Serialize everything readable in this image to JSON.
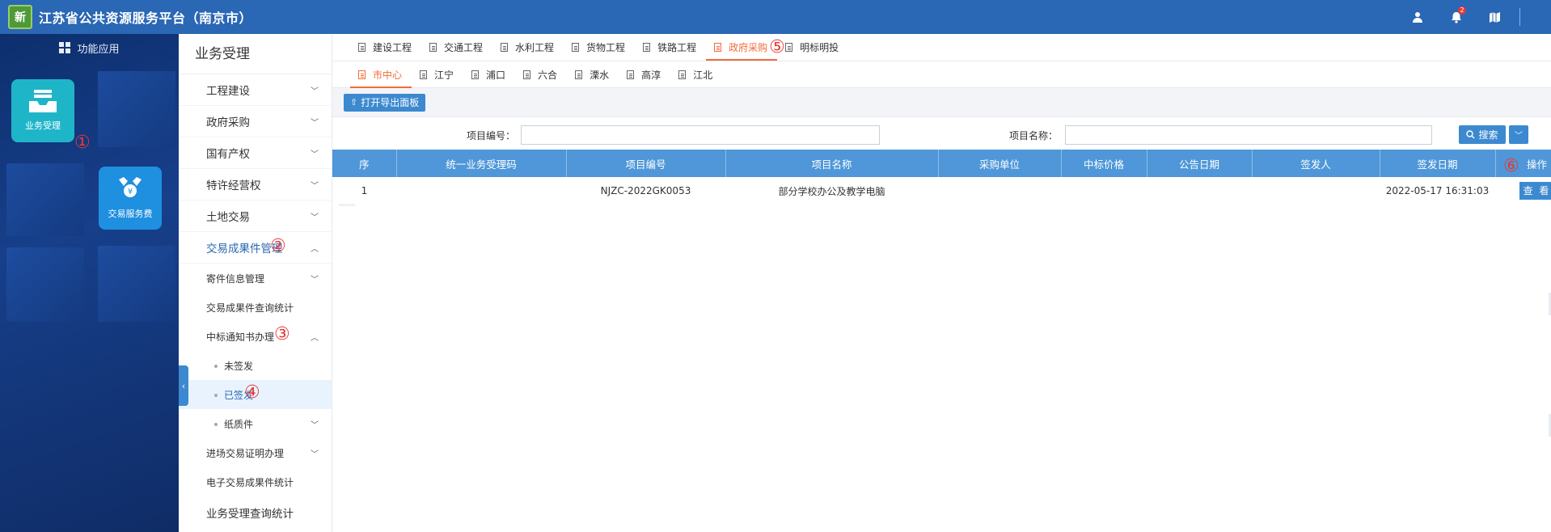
{
  "header": {
    "logo_text": "新",
    "title": "江苏省公共资源服务平台（南京市）",
    "icons": [
      "user-icon",
      "bell-icon",
      "map-icon"
    ],
    "notification_count": "2"
  },
  "left_panel": {
    "header_label": "功能应用",
    "apps": [
      {
        "label": "业务受理",
        "icon": "inbox-icon",
        "marker": "①"
      },
      {
        "label": "交易服务费",
        "icon": "fee-icon"
      }
    ]
  },
  "sidebar": {
    "title": "业务受理",
    "items": [
      {
        "label": "工程建设",
        "expanded": false
      },
      {
        "label": "政府采购",
        "expanded": false
      },
      {
        "label": "国有产权",
        "expanded": false
      },
      {
        "label": "特许经营权",
        "expanded": false
      },
      {
        "label": "土地交易",
        "expanded": false
      },
      {
        "label": "交易成果件管理",
        "expanded": true,
        "marker": "②"
      }
    ],
    "sub_items": [
      {
        "label": "寄件信息管理",
        "expanded": false
      },
      {
        "label": "交易成果件查询统计"
      },
      {
        "label": "中标通知书办理",
        "expanded": true,
        "marker": "③"
      }
    ],
    "leaf_items": [
      {
        "label": "未签发"
      },
      {
        "label": "已签发",
        "selected": true,
        "marker": "④"
      },
      {
        "label": "纸质件",
        "expanded": false
      }
    ],
    "more_items": [
      {
        "label": "进场交易证明办理",
        "expanded": false
      },
      {
        "label": "电子交易成果件统计"
      }
    ],
    "bottom_item": "业务受理查询统计"
  },
  "tabs_primary": {
    "items": [
      "建设工程",
      "交通工程",
      "水利工程",
      "货物工程",
      "铁路工程",
      "政府采购",
      "明标明投"
    ],
    "active": "政府采购",
    "marker": "⑤"
  },
  "tabs_secondary": {
    "items": [
      "市中心",
      "江宁",
      "浦口",
      "六合",
      "溧水",
      "高淳",
      "江北"
    ],
    "active": "市中心"
  },
  "toolbar": {
    "export_label": "打开导出面板"
  },
  "search": {
    "code_label": "项目编号：",
    "code_value": "",
    "name_label": "项目名称：",
    "name_value": "",
    "search_label": "搜索"
  },
  "table": {
    "columns": [
      "序",
      "统一业务受理码",
      "项目编号",
      "项目名称",
      "采购单位",
      "中标价格",
      "公告日期",
      "签发人",
      "签发日期",
      "操作"
    ],
    "rows": [
      {
        "index": "1",
        "acceptance_code": "",
        "project_code": "NJZC-2022GK0053",
        "project_name": "部分学校办公及教学电脑",
        "purchaser": "",
        "bid_price": "",
        "notice_date": "",
        "issuer": "",
        "issue_date": "2022-05-17 16:31:03",
        "action_label": "查 看"
      }
    ],
    "action_marker": "⑥"
  },
  "colors": {
    "header_bg": "#2a67b4",
    "accent_orange": "#f26b3a",
    "table_header_bg": "#4f97d8",
    "marker_red": "#e53935"
  }
}
